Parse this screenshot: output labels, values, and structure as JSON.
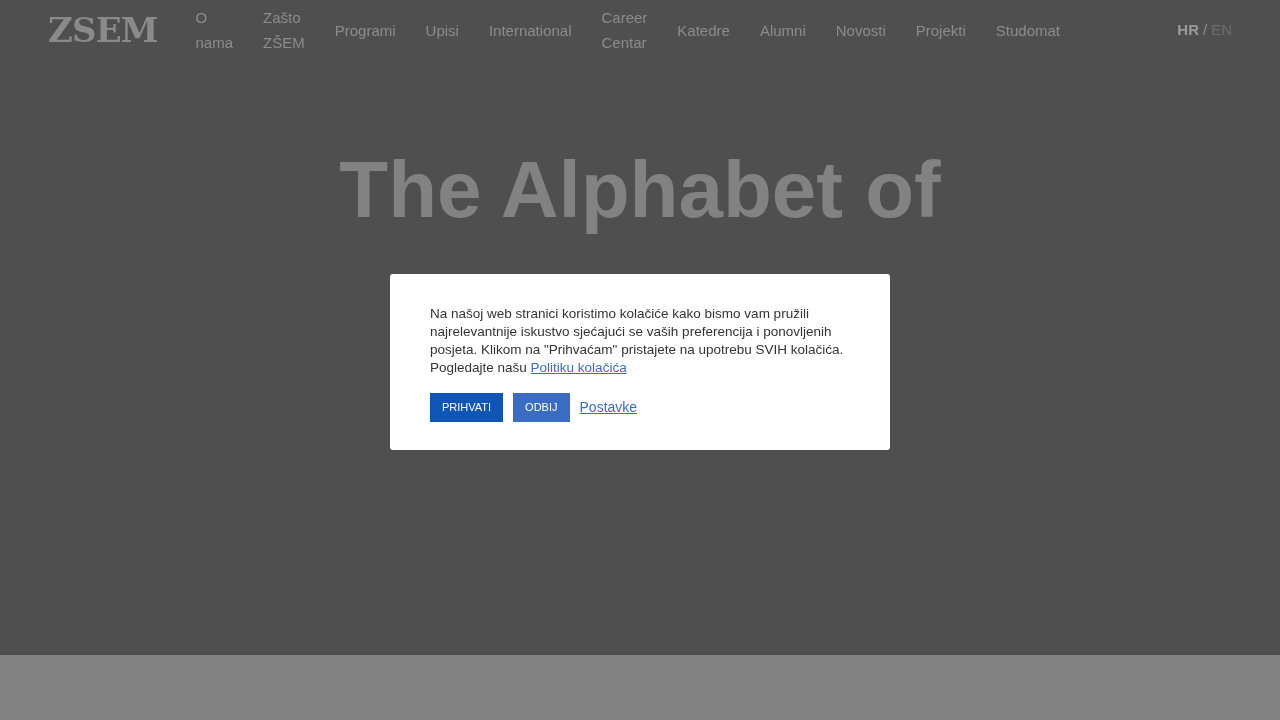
{
  "header": {
    "logo": "ZSEM",
    "nav": [
      {
        "label": "O nama"
      },
      {
        "label": "Zašto ZŠEM"
      },
      {
        "label": "Programi"
      },
      {
        "label": "Upisi"
      },
      {
        "label": "International"
      },
      {
        "label": "Career Centar"
      },
      {
        "label": "Katedre"
      },
      {
        "label": "Alumni"
      },
      {
        "label": "Novosti"
      },
      {
        "label": "Projekti"
      },
      {
        "label": "Studomat"
      }
    ],
    "languages": [
      {
        "label": "HR",
        "selected": true
      },
      {
        "label": "EN",
        "selected": false
      }
    ],
    "language_separator": "/"
  },
  "hero": {
    "title": "The Alphabet of"
  },
  "cookie_dialog": {
    "text": "Na našoj web stranici koristimo kolačiće kako bismo vam pružili najrelevantnije iskustvo sjećajući se vaših preferencija i ponovljenih posjeta. Klikom na \"Prihvaćam\" pristajete na upotrebu SVIH kolačića. Pogledajte našu",
    "policy_link": "Politiku kolačića",
    "buttons": [
      {
        "label": "PRIHVATI",
        "kind": "primary"
      },
      {
        "label": "ODBIJ",
        "kind": "secondary"
      },
      {
        "label": "Postavke",
        "kind": "link"
      }
    ]
  }
}
